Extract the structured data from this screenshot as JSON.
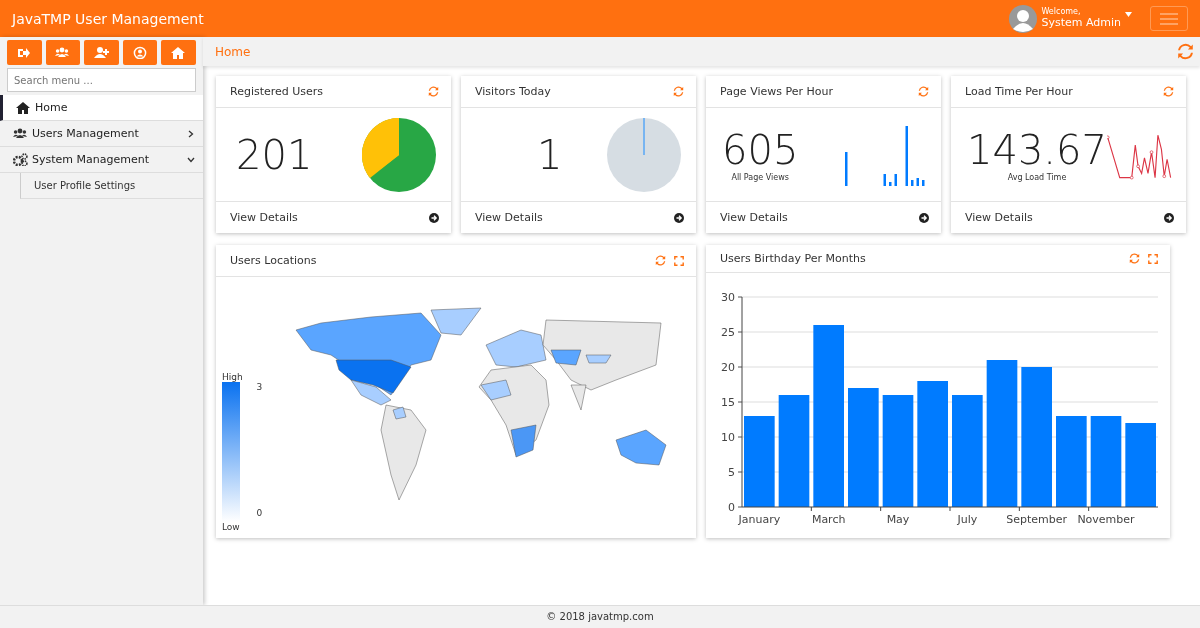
{
  "header": {
    "title": "JavaTMP User Management",
    "welcome": "Welcome,",
    "user": "System Admin"
  },
  "sidebar": {
    "search": {
      "placeholder": "Search menu ..."
    },
    "items": [
      {
        "label": "Home",
        "selected": true
      },
      {
        "label": "Users Management",
        "selected": false,
        "expanded": false
      },
      {
        "label": "System Management",
        "selected": false,
        "expanded": true,
        "children": [
          {
            "label": "User Profile Settings",
            "selected": false
          }
        ]
      }
    ]
  },
  "breadcrumb": "Home",
  "stat_cards": [
    {
      "kind": "pie",
      "title": "Registered Users",
      "value": "201",
      "link": "View Details"
    },
    {
      "kind": "empty_pie",
      "title": "Visitors Today",
      "value": "1",
      "link": "View Details"
    },
    {
      "kind": "bars",
      "title": "Page Views Per Hour",
      "value": "605",
      "caption": "All Page Views",
      "link": "View Details"
    },
    {
      "kind": "line",
      "title": "Load Time Per Hour",
      "value": "143.67",
      "caption": "Avg Load Time",
      "link": "View Details"
    }
  ],
  "map_panel": {
    "title": "Users Locations",
    "legend": {
      "high": "High",
      "max": "3",
      "min": "0",
      "low": "Low"
    }
  },
  "chart_panel": {
    "title": "Users Birthday Per Months",
    "chart_data": {
      "type": "bar",
      "ylim": [
        0,
        30
      ],
      "yticks": [
        0,
        5,
        10,
        15,
        20,
        25,
        30
      ],
      "grid": true,
      "categories": [
        "January",
        null,
        "March",
        null,
        "May",
        null,
        "July",
        null,
        "September",
        null,
        "November",
        null
      ],
      "values": [
        13,
        16,
        26,
        17,
        16,
        18,
        16,
        21,
        20,
        13,
        13,
        12
      ]
    }
  },
  "footer": "© 2018 javatmp.com"
}
